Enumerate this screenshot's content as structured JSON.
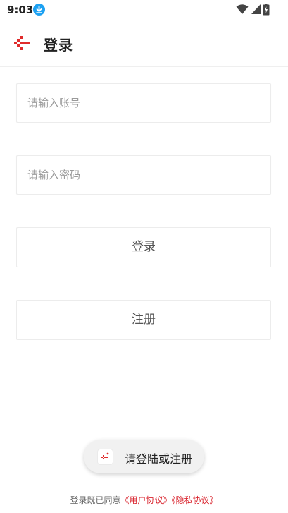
{
  "status_bar": {
    "time": "9:03",
    "icons": [
      "download-icon",
      "wifi-icon",
      "signal-icon",
      "battery-icon"
    ]
  },
  "app_bar": {
    "title": "登录",
    "back_icon": "back-arrow-icon"
  },
  "form": {
    "account_placeholder": "请输入账号",
    "account_value": "",
    "password_placeholder": "请输入密码",
    "password_value": "",
    "login_label": "登录",
    "register_label": "注册"
  },
  "toast": {
    "text": "请登陆或注册"
  },
  "agreement": {
    "prefix": "登录既已同意",
    "user_agreement": "《用户协议》",
    "privacy_agreement": "《隐私协议》"
  },
  "colors": {
    "accent": "#d9232d",
    "download_badge": "#1da1f2",
    "border": "#ececec"
  }
}
